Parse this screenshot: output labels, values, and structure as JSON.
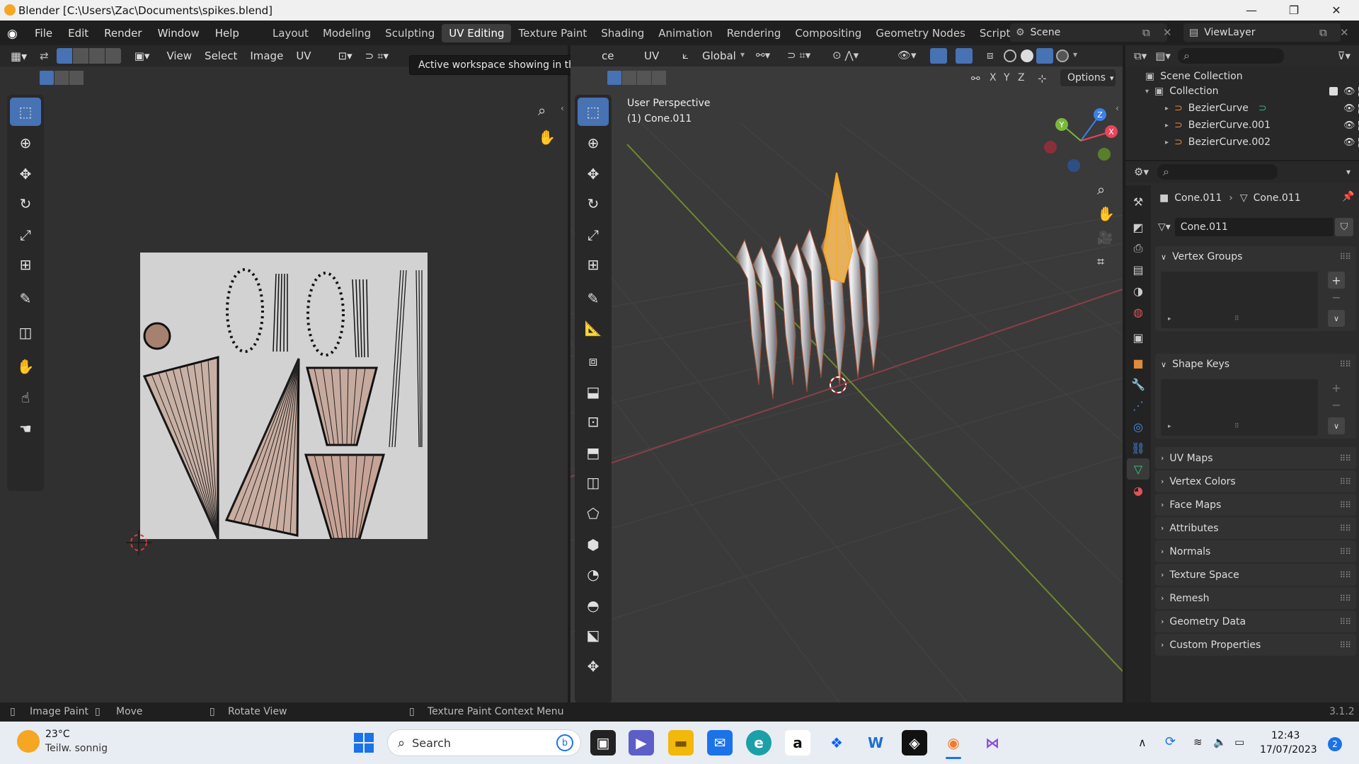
{
  "window": {
    "title": "Blender [C:\\Users\\Zac\\Documents\\spikes.blend]",
    "controls": [
      "—",
      "❐",
      "✕"
    ]
  },
  "menubar": {
    "items": [
      "File",
      "Edit",
      "Render",
      "Window",
      "Help"
    ],
    "workspaces": [
      "Layout",
      "Modeling",
      "Sculpting",
      "UV Editing",
      "Texture Paint",
      "Shading",
      "Animation",
      "Rendering",
      "Compositing",
      "Geometry Nodes",
      "Scripting"
    ],
    "active_workspace": "UV Editing",
    "add_tab": "+",
    "scene": "Scene",
    "view_layer": "ViewLayer"
  },
  "tooltip": "Active workspace showing in the window.",
  "uv_editor": {
    "menus": [
      "View",
      "Select",
      "Image",
      "UV"
    ]
  },
  "viewport": {
    "menus_partial": [
      "ce",
      "UV"
    ],
    "orientation": "Global",
    "overlay_label": "User Perspective",
    "object_label": "(1) Cone.011",
    "axes": [
      "X",
      "Y",
      "Z"
    ],
    "options_label": "Options",
    "gizmo": {
      "x": "X",
      "y": "Y",
      "z": "Z"
    }
  },
  "outliner": {
    "root": "Scene Collection",
    "collection": "Collection",
    "items": [
      "BezierCurve",
      "BezierCurve.001",
      "BezierCurve.002"
    ]
  },
  "properties": {
    "breadcrumb_object": "Cone.011",
    "breadcrumb_data": "Cone.011",
    "mesh_name": "Cone.011",
    "vertex_groups": "Vertex Groups",
    "shape_keys": "Shape Keys",
    "collapsed_panels": [
      "UV Maps",
      "Vertex Colors",
      "Face Maps",
      "Attributes",
      "Normals",
      "Texture Space",
      "Remesh",
      "Geometry Data",
      "Custom Properties"
    ]
  },
  "statusbar": {
    "items": [
      "Image Paint",
      "Move",
      "Rotate View",
      "Texture Paint Context Menu"
    ],
    "version": "3.1.2"
  },
  "taskbar": {
    "weather_temp": "23°C",
    "weather_desc": "Teilw. sonnig",
    "search_placeholder": "Search",
    "time": "12:43",
    "date": "17/07/2023",
    "notif_count": "2"
  },
  "colors": {
    "accent": "#4772b3",
    "selected_orange": "#f5a623",
    "x_axis": "#e8455a",
    "y_axis": "#7ab83d",
    "z_axis": "#3d7fe8"
  }
}
